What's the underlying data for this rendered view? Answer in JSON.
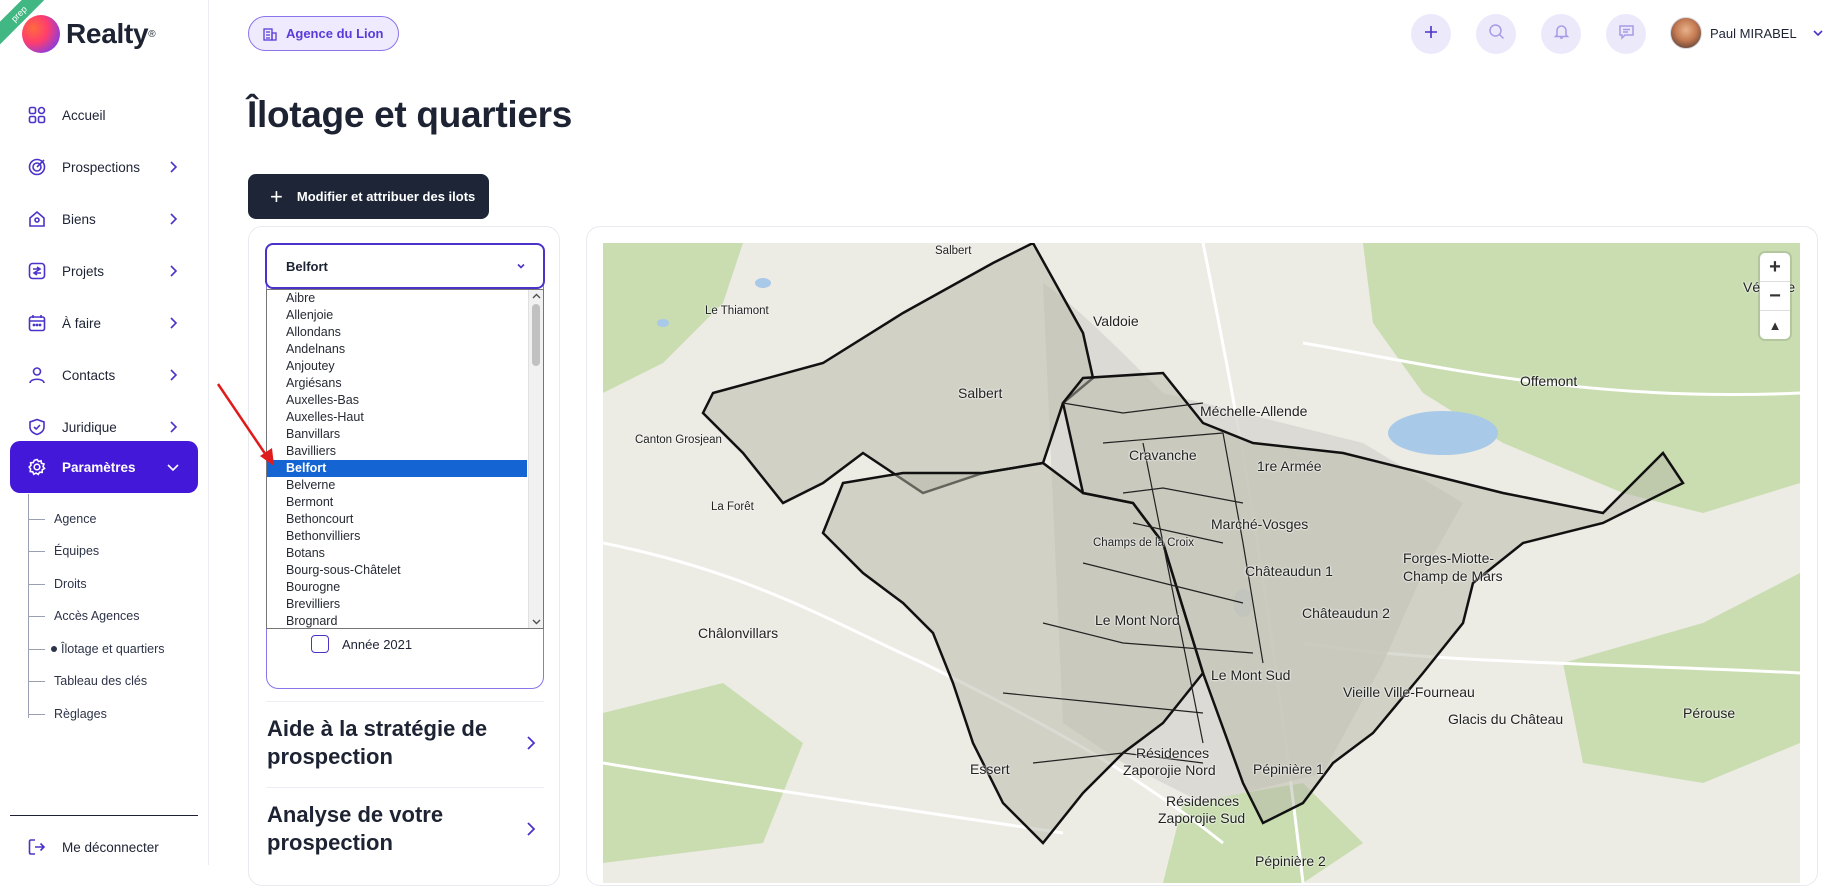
{
  "app": {
    "brand": "Realty",
    "ribbon": "prep"
  },
  "sidebar": {
    "items": [
      {
        "label": "Accueil",
        "icon": "grid-icon"
      },
      {
        "label": "Prospections",
        "icon": "target-icon"
      },
      {
        "label": "Biens",
        "icon": "house-icon"
      },
      {
        "label": "Projets",
        "icon": "project-icon"
      },
      {
        "label": "À faire",
        "icon": "calendar-icon"
      },
      {
        "label": "Contacts",
        "icon": "user-icon"
      },
      {
        "label": "Juridique",
        "icon": "shield-check-icon"
      },
      {
        "label": "Paramètres",
        "icon": "gear-icon"
      }
    ],
    "subitems": [
      "Agence",
      "Équipes",
      "Droits",
      "Accès Agences",
      "Îlotage et quartiers",
      "Tableau des clés",
      "Règlages"
    ],
    "logout": "Me déconnecter"
  },
  "header": {
    "agency": "Agence du Lion",
    "user_name": "Paul MIRABEL"
  },
  "page": {
    "title": "Îlotage et quartiers",
    "action_button": "Modifier et attribuer des ilots"
  },
  "filters": {
    "city_selected": "Belfort",
    "city_options": [
      "Aibre",
      "Allenjoie",
      "Allondans",
      "Andelnans",
      "Anjoutey",
      "Argiésans",
      "Auxelles-Bas",
      "Auxelles-Haut",
      "Banvillars",
      "Bavilliers",
      "Belfort",
      "Belverne",
      "Bermont",
      "Bethoncourt",
      "Bethonvilliers",
      "Botans",
      "Bourg-sous-Châtelet",
      "Bourogne",
      "Brevilliers",
      "Brognard"
    ],
    "year_label": "Année 2021"
  },
  "accordions": [
    {
      "title": "Aide à la stratégie de prospection"
    },
    {
      "title": "Analyse de votre prospection"
    }
  ],
  "map": {
    "labels": {
      "salbert_top": "Salbert",
      "le_thiamont": "Le Thiamont",
      "valdoie": "Valdoie",
      "vetrigne": "Vétrigne",
      "offemont": "Offemont",
      "salbert": "Salbert",
      "canton_grosjean": "Canton Grosjean",
      "mechelle": "Méchelle-Allende",
      "cravanche": "Cravanche",
      "premiere_armee": "1re Armée",
      "la_foret": "La Forêt",
      "marche_vosges": "Marché-Vosges",
      "champs_croix": "Champs de la Croix",
      "forges": "Forges-Miotte-",
      "champ_mars": "Champ de Mars",
      "chateaudun1": "Châteaudun 1",
      "chalonvillars": "Châlonvillars",
      "mont_nord": "Le Mont Nord",
      "chateaudun2": "Châteaudun 2",
      "mont_sud": "Le Mont Sud",
      "vieille_ville": "Vieille Ville-Fourneau",
      "glacis": "Glacis du Château",
      "perouse": "Pérouse",
      "residences_nord_1": "Résidences",
      "residences_nord_2": "Zaporojie Nord",
      "essert": "Essert",
      "pepiniere1": "Pépinière 1",
      "residences_sud_1": "Résidences",
      "residences_sud_2": "Zaporojie Sud",
      "pepiniere2": "Pépinière 2"
    },
    "controls": {
      "zoom_in": "+",
      "zoom_out": "−",
      "north": "▲"
    }
  },
  "colors": {
    "accent": "#4318d8",
    "dark_button": "#1d2537",
    "selection": "#1464d4"
  }
}
